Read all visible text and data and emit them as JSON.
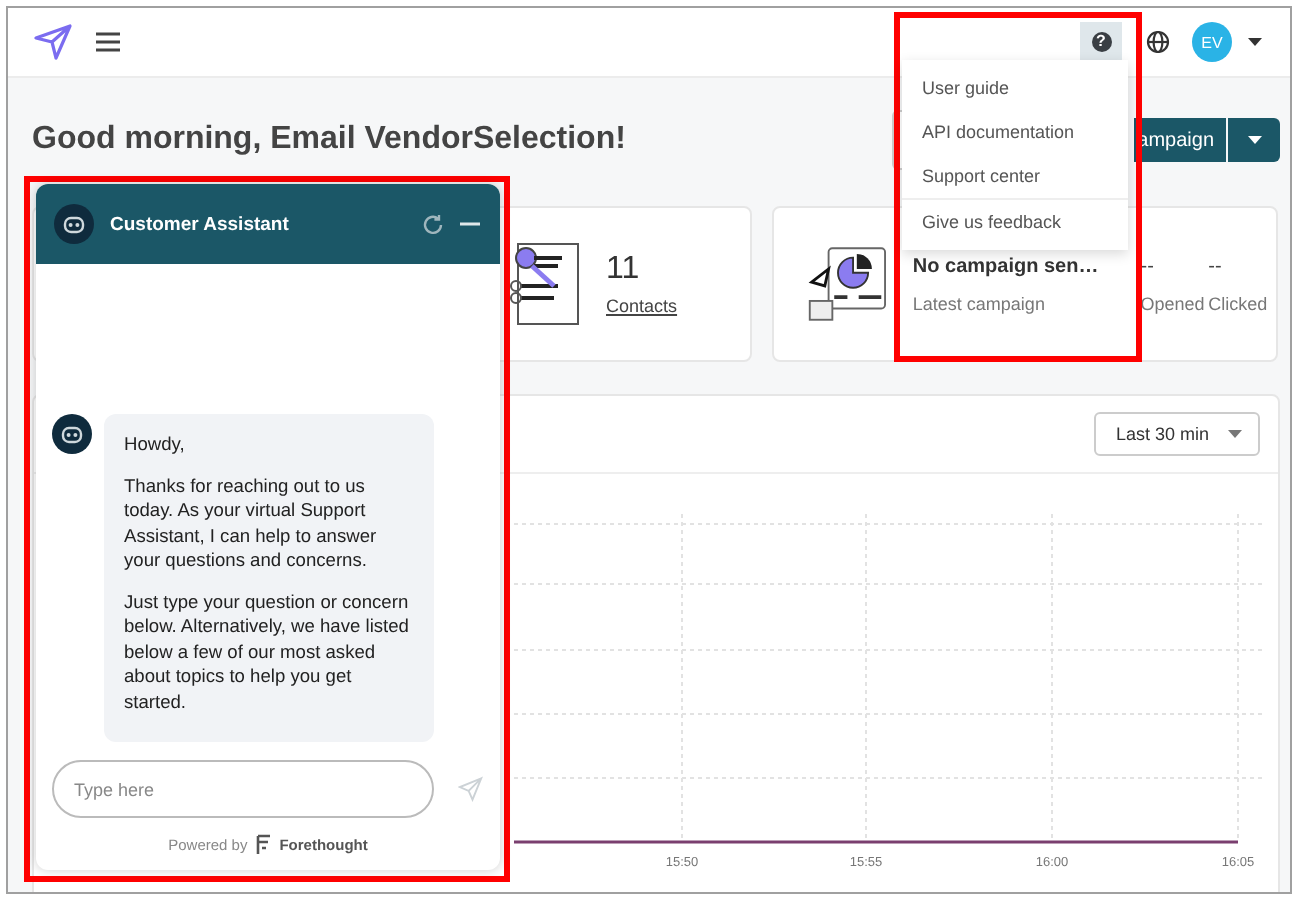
{
  "header": {
    "help_glyph": "?",
    "avatar_initials": "EV"
  },
  "help_menu": {
    "items": [
      {
        "label": "User guide"
      },
      {
        "label": "API documentation"
      },
      {
        "label": "Support center"
      },
      {
        "label": "Give us feedback"
      }
    ]
  },
  "greeting": "Good morning, Email VendorSelection!",
  "primary_button": {
    "label": "ampaign"
  },
  "stats": {
    "contacts": {
      "value": "11",
      "label": "Contacts"
    },
    "campaign": {
      "name": "No campaign sen…",
      "caption": "Latest campaign",
      "metrics": [
        {
          "value": "--",
          "label": "Opened"
        },
        {
          "value": "--",
          "label": "Clicked"
        }
      ]
    }
  },
  "chart": {
    "range_select": "Last 30 min",
    "x_ticks": [
      "15:50",
      "15:55",
      "16:00",
      "16:05"
    ]
  },
  "chat": {
    "title": "Customer Assistant",
    "messages": [
      "Howdy,",
      "Thanks for reaching out to us today. As your virtual Support Assistant, I can help to answer your questions and concerns.",
      "Just type your question or concern below. Alternatively, we have listed below a few of our most asked about topics to help you get started."
    ],
    "input_placeholder": "Type here",
    "powered_by": "Powered by",
    "brand": "Forethought"
  }
}
